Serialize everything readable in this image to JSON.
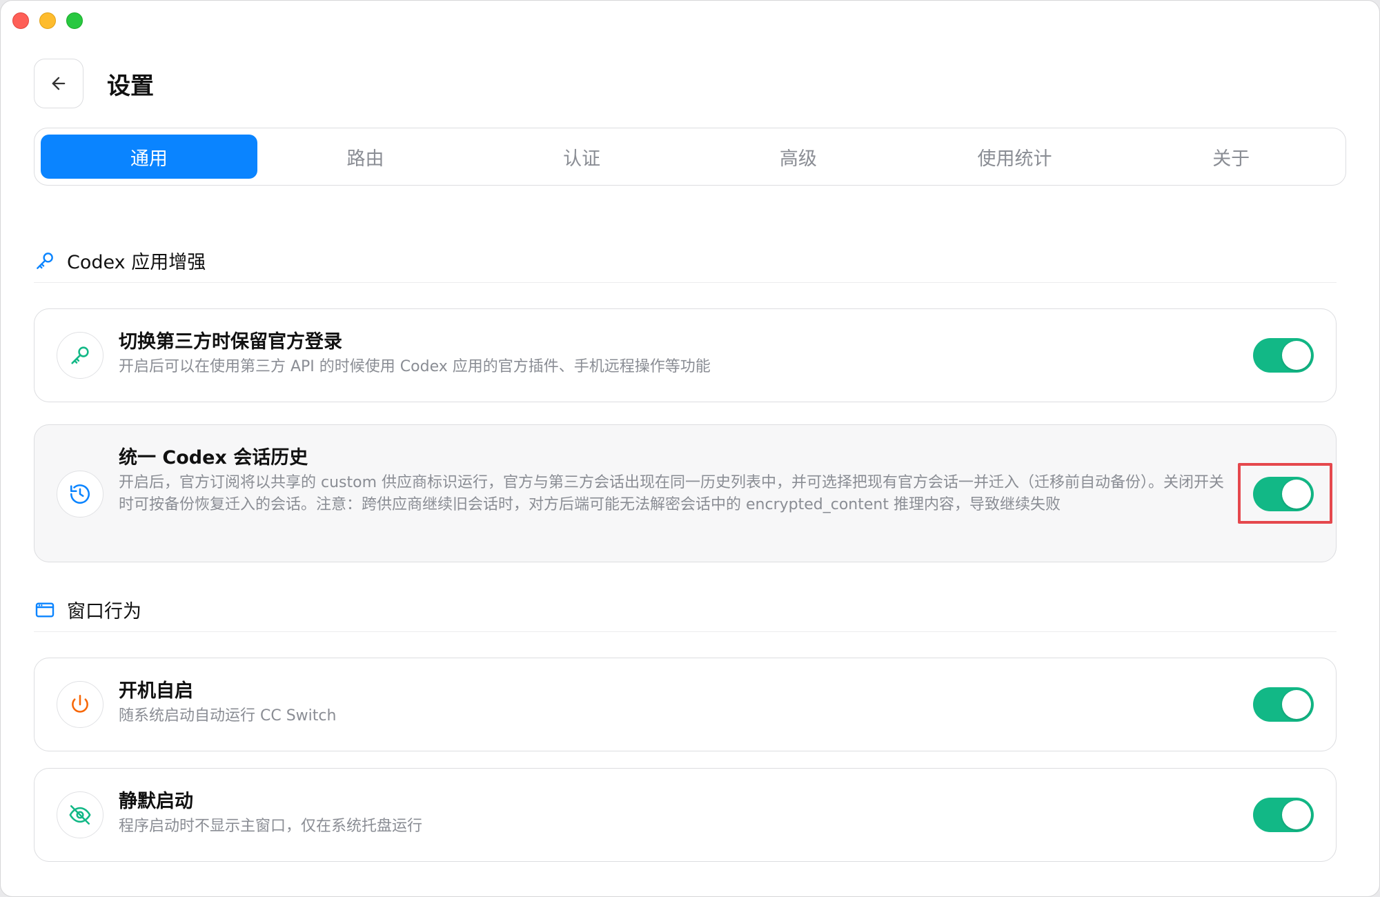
{
  "window": {
    "controls": [
      "close",
      "minimize",
      "zoom"
    ]
  },
  "header": {
    "back_icon": "arrow-left-icon",
    "title": "设置"
  },
  "tabs": [
    {
      "label": "通用",
      "active": true
    },
    {
      "label": "路由",
      "active": false
    },
    {
      "label": "认证",
      "active": false
    },
    {
      "label": "高级",
      "active": false
    },
    {
      "label": "使用统计",
      "active": false
    },
    {
      "label": "关于",
      "active": false
    }
  ],
  "sections": [
    {
      "title": "Codex 应用增强",
      "icon": "key-icon",
      "items": [
        {
          "title": "切换第三方时保留官方登录",
          "description": "开启后可以在使用第三方 API 的时候使用 Codex 应用的官方插件、手机远程操作等功能",
          "icon": "key-icon",
          "enabled": true
        },
        {
          "title": "统一 Codex 会话历史",
          "description": "开启后，官方订阅将以共享的 custom 供应商标识运行，官方与第三方会话出现在同一历史列表中，并可选择把现有官方会话一并迁入（迁移前自动备份）。关闭开关时可按备份恢复迁入的会话。注意：跨供应商继续旧会话时，对方后端可能无法解密会话中的 encrypted_content 推理内容，导致继续失败",
          "icon": "history-icon",
          "enabled": true
        }
      ]
    },
    {
      "title": "窗口行为",
      "icon": "window-icon",
      "items": [
        {
          "title": "开机自启",
          "description": "随系统启动自动运行 CC Switch",
          "icon": "power-icon",
          "enabled": true
        },
        {
          "title": "静默启动",
          "description": "程序启动时不显示主窗口，仅在系统托盘运行",
          "icon": "eye-off-icon",
          "enabled": true
        }
      ]
    }
  ],
  "colors": {
    "accent": "#0a84ff",
    "toggle_on": "#12b886",
    "highlight_border": "#e5484d"
  }
}
